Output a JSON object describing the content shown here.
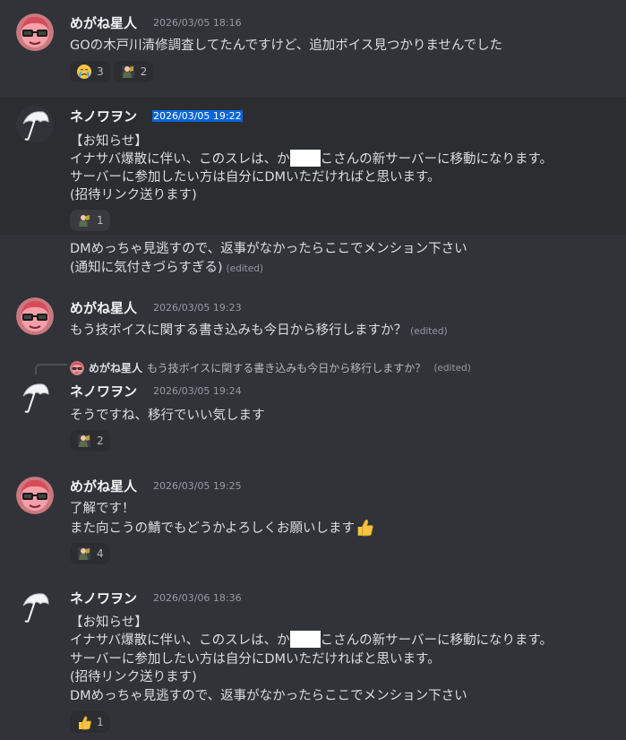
{
  "messages": [
    {
      "user": "めがね星人",
      "timestamp": "2026/03/05 18:16",
      "lines": [
        "GOの木戸川清修調査してたんですけど、追加ボイス見つかりませんでした"
      ],
      "reactions": [
        {
          "emoji": "crying-face-icon",
          "count": "3"
        },
        {
          "emoji": "agent-figure-icon",
          "count": "2"
        }
      ]
    },
    {
      "user": "ネノワヲン",
      "timestamp": "2026/03/05 19:22",
      "lines": [
        "【お知らせ】",
        "イナサバ爆散に伴い、このスレは、か",
        "こさんの新サーバーに移動になります。",
        "サーバーに参加したい方は自分にDMいただければと思います。",
        "(招待リンク送ります)"
      ],
      "reactions": [
        {
          "emoji": "agent-figure-icon",
          "count": "1"
        }
      ]
    },
    {
      "lines": [
        "DMめっちゃ見逃すので、返事がなかったらここでメンション下さい",
        "(通知に気付きづらすぎる)"
      ],
      "edited": "(edited)"
    },
    {
      "user": "めがね星人",
      "timestamp": "2026/03/05 19:23",
      "lines": [
        "もう技ボイスに関する書き込みも今日から移行しますか？"
      ],
      "edited": "(edited)"
    },
    {
      "reply": {
        "user": "めがね星人",
        "text": "もう技ボイスに関する書き込みも今日から移行しますか？",
        "edited": "(edited)"
      },
      "user": "ネノワヲン",
      "timestamp": "2026/03/05 19:24",
      "lines": [
        "そうですね、移行でいい気します"
      ],
      "reactions": [
        {
          "emoji": "agent-figure-icon",
          "count": "2"
        }
      ]
    },
    {
      "user": "めがね星人",
      "timestamp": "2026/03/05 19:25",
      "lines": [
        "了解です！",
        "また向こうの鯖でもどうかよろしくお願いします"
      ],
      "reactions": [
        {
          "emoji": "agent-figure-icon",
          "count": "4"
        }
      ]
    },
    {
      "user": "ネノワヲン",
      "timestamp": "2026/03/06 18:36",
      "lines": [
        "【お知らせ】",
        "イナサバ爆散に伴い、このスレは、か",
        "こさんの新サーバーに移動になります。",
        "サーバーに参加したい方は自分にDMいただければと思います。",
        "(招待リンク送ります)",
        "DMめっちゃ見逃すので、返事がなかったらここでメンション下さい"
      ],
      "reactions": [
        {
          "emoji": "thumbs-up-icon",
          "count": "1"
        }
      ]
    }
  ],
  "colors": {
    "background": "#313338",
    "highlight": "#2b2d31",
    "selection": "#0a64d6",
    "muted": "#949ba4"
  }
}
